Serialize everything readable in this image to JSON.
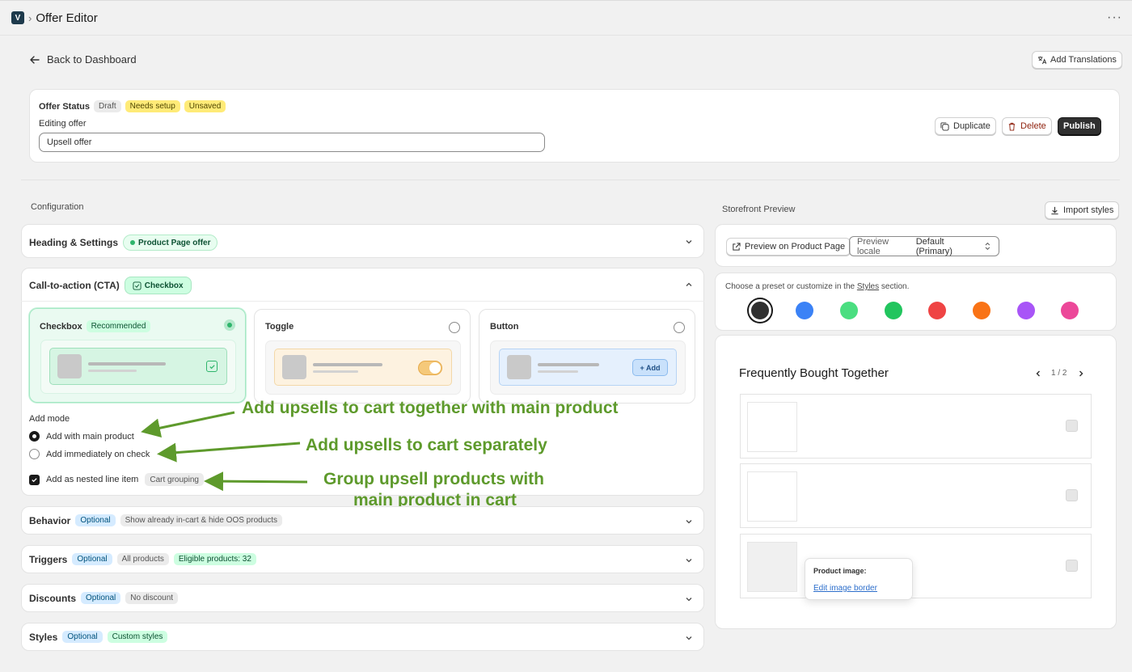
{
  "header": {
    "logo_glyph": "V",
    "title": "Offer Editor",
    "more_glyph": "···"
  },
  "nav": {
    "back_label": "Back to Dashboard",
    "add_translations": "Add Translations"
  },
  "status": {
    "label": "Offer Status",
    "badges": [
      "Draft",
      "Needs setup",
      "Unsaved"
    ],
    "editing_label": "Editing offer",
    "name_value": "Upsell offer",
    "duplicate": "Duplicate",
    "delete": "Delete",
    "publish": "Publish"
  },
  "config": {
    "title": "Configuration",
    "heading_section": {
      "title": "Heading & Settings",
      "badge": "Product Page offer"
    },
    "cta_section": {
      "title": "Call-to-action (CTA)",
      "badge": "Checkbox",
      "options": [
        {
          "label": "Checkbox",
          "tag": "Recommended"
        },
        {
          "label": "Toggle"
        },
        {
          "label": "Button",
          "button_text": "+ Add"
        }
      ],
      "add_mode_label": "Add mode",
      "mode_main": "Add with main product",
      "mode_immediate": "Add immediately on check",
      "nested_label": "Add as nested line item",
      "nested_tag": "Cart grouping"
    },
    "behavior": {
      "title": "Behavior",
      "optional": "Optional",
      "note": "Show already in-cart & hide OOS products"
    },
    "triggers": {
      "title": "Triggers",
      "optional": "Optional",
      "note": "All products",
      "eligible": "Eligible products: 32"
    },
    "discounts": {
      "title": "Discounts",
      "optional": "Optional",
      "note": "No discount"
    },
    "styles": {
      "title": "Styles",
      "optional": "Optional",
      "custom": "Custom styles"
    }
  },
  "annotations": {
    "a1": "Add upsells to cart together with main product",
    "a2": "Add upsells to cart separately",
    "a3_line1": "Group upsell products with",
    "a3_line2": "main product in cart"
  },
  "preview": {
    "title": "Storefront Preview",
    "import_styles": "Import styles",
    "preview_button": "Preview on Product Page",
    "locale_label": "Preview locale",
    "locale_value": "Default (Primary)",
    "preset_text_before": "Choose a preset or customize in the",
    "preset_link": "Styles",
    "preset_text_after": "section.",
    "swatches": [
      "#303030",
      "#3b82f6",
      "#4ade80",
      "#22c55e",
      "#ef4444",
      "#f97316",
      "#a855f7",
      "#ec4899"
    ],
    "widget_title": "Frequently Bought Together",
    "pager": "1 / 2",
    "tooltip_title": "Product image:",
    "tooltip_link": "Edit image border"
  }
}
